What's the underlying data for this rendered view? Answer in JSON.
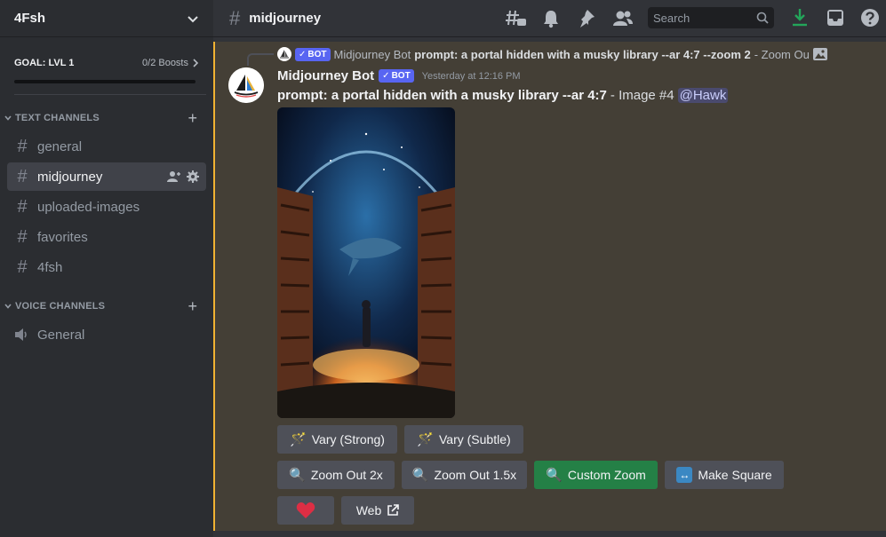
{
  "server": {
    "name": "4Fsh"
  },
  "goal": {
    "label": "GOAL: LVL 1",
    "count": "0/2 Boosts"
  },
  "sections": {
    "text": "TEXT CHANNELS",
    "voice": "VOICE CHANNELS"
  },
  "text_channels": [
    {
      "name": "general"
    },
    {
      "name": "midjourney"
    },
    {
      "name": "uploaded-images"
    },
    {
      "name": "favorites"
    },
    {
      "name": "4fsh"
    }
  ],
  "voice_channels": [
    {
      "name": "General"
    }
  ],
  "topbar": {
    "channel": "midjourney",
    "search_placeholder": "Search"
  },
  "reply": {
    "author": "Midjourney Bot",
    "bot_tag": "BOT",
    "text": "prompt: a portal hidden with a musky library --ar 4:7 --zoom 2",
    "tail": "- Zoom Ou"
  },
  "message": {
    "author": "Midjourney Bot",
    "bot_tag": "BOT",
    "timestamp": "Yesterday at 12:16 PM",
    "prompt": "prompt: a portal hidden with a musky library --ar 4:7",
    "suffix": "- Image #4",
    "mention": "@Hawk"
  },
  "buttons": {
    "vary_strong": "Vary (Strong)",
    "vary_subtle": "Vary (Subtle)",
    "zoom_2x": "Zoom Out 2x",
    "zoom_15x": "Zoom Out 1.5x",
    "custom_zoom": "Custom Zoom",
    "make_square": "Make Square",
    "web": "Web"
  },
  "colors": {
    "accent_green": "#248046",
    "highlight_border": "#f0b232",
    "bot_tag": "#5865f2",
    "download_icon": "#23a55a"
  }
}
